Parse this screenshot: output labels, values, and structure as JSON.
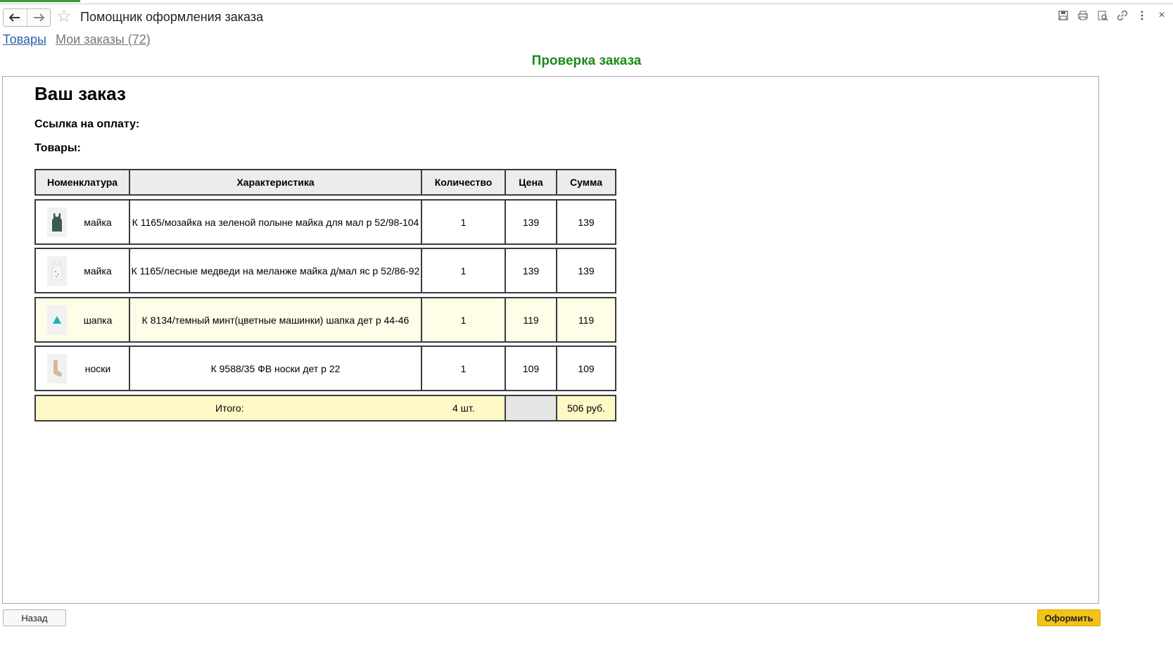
{
  "window": {
    "title": "Помощник оформления заказа"
  },
  "nav": {
    "back_icon": "arrow-left-icon",
    "forward_icon": "arrow-right-icon",
    "favorite_icon": "star-icon"
  },
  "toolbar": {
    "icons": [
      "save-icon",
      "print-icon",
      "preview-icon",
      "link-icon",
      "more-icon",
      "close-icon"
    ]
  },
  "links": {
    "goods": "Товары",
    "my_orders": "Мои заказы (72)"
  },
  "section_header": "Проверка заказа",
  "order": {
    "title": "Ваш заказ",
    "payment_link_label": "Ссылка на оплату:",
    "goods_label": "Товары:",
    "columns": {
      "nomenclature": "Номенклатура",
      "characteristic": "Характеристика",
      "quantity": "Количество",
      "price": "Цена",
      "sum": "Сумма"
    },
    "rows": [
      {
        "name": "майка",
        "characteristic": "К 1165/мозайка на зеленой полыне майка для мал р 52/98-104",
        "quantity": "1",
        "price": "139",
        "sum": "139",
        "thumb": "tank-top-green-icon"
      },
      {
        "name": "майка",
        "characteristic": "К 1165/лесные медведи на меланже майка д/мал яс р 52/86-92",
        "quantity": "1",
        "price": "139",
        "sum": "139",
        "thumb": "tank-top-white-icon"
      },
      {
        "name": "шапка",
        "characteristic": "К 8134/темный минт(цветные машинки) шапка дет р 44-46",
        "quantity": "1",
        "price": "119",
        "sum": "119",
        "thumb": "hat-teal-icon"
      },
      {
        "name": "носки",
        "characteristic": "К 9588/35 ФВ носки дет р 22",
        "quantity": "1",
        "price": "109",
        "sum": "109",
        "thumb": "sock-beige-icon"
      }
    ],
    "total": {
      "label": "Итого:",
      "quantity": "4 шт.",
      "sum": "506 руб."
    }
  },
  "footer": {
    "back_label": "Назад",
    "submit_label": "Оформить"
  },
  "colors": {
    "header_green": "#1b8a1b",
    "submit_yellow": "#f2c419",
    "total_row": "#fef9c6",
    "highlight_row": "#fffce8"
  }
}
